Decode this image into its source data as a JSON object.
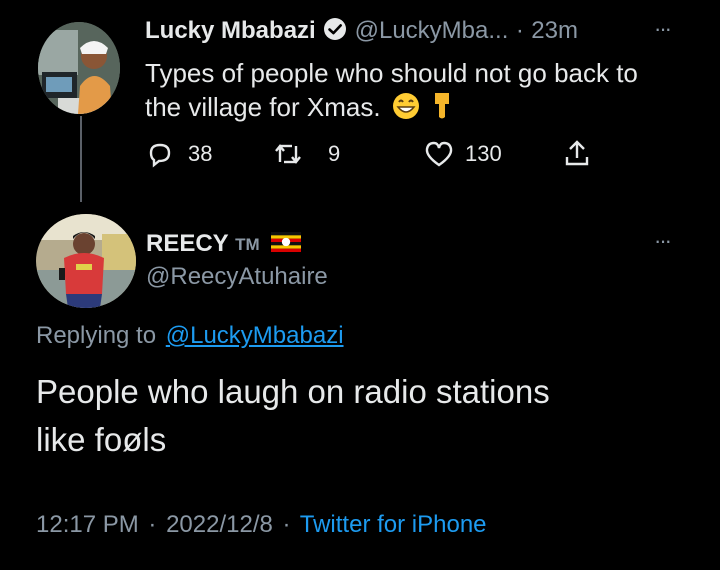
{
  "parent_tweet": {
    "display_name": "Lucky Mbabazi",
    "handle": "@LuckyMba...",
    "separator": "·",
    "time_ago": "23m",
    "more": "···",
    "text_line1": "Types of people who should not go back to",
    "text_line2": "the village for Xmas.",
    "emojis": "😁👇",
    "replies": "38",
    "retweets": "9",
    "likes": "130"
  },
  "reply_tweet": {
    "display_name": "REECY",
    "tm": "TM",
    "handle": "@ReecyAtuhaire",
    "more": "···",
    "replying_prefix": "Replying to",
    "replying_to": "@LuckyMbabazi",
    "text_line1": "People who laugh on radio stations",
    "text_line2": "like foøls",
    "time": "12:17 PM",
    "sep1": "·",
    "date": "2022/12/8",
    "sep2": "·",
    "source": "Twitter for iPhone"
  },
  "colors": {
    "background": "#000000",
    "text": "#e7e9ea",
    "muted": "#8b98a5",
    "link": "#1d9bf0",
    "verified": "#1d9bf0",
    "thread_line": "#5b6068"
  }
}
